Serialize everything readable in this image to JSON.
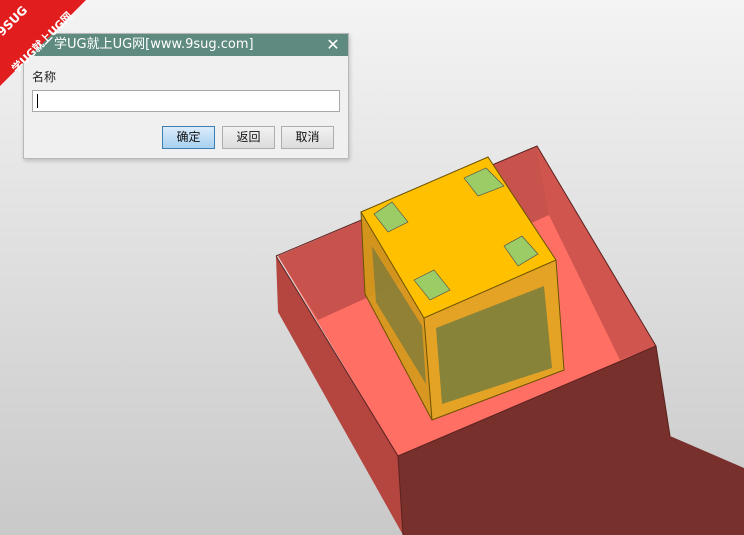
{
  "watermark": {
    "line1": "9SUG",
    "line2": "学UG就上UG网"
  },
  "dialog": {
    "title": "学UG就上UG网[www.9sug.com]",
    "field_label": "名称",
    "name_value": "",
    "close_icon": "close-icon",
    "buttons": {
      "ok": "确定",
      "back": "返回",
      "cancel": "取消"
    }
  },
  "scene": {
    "background": "#dcdcdc",
    "box_color": "#c0504d",
    "box_floor_color": "#ff6f64",
    "cube_color": "#ffc000",
    "marker_color": "#9ccc65"
  }
}
